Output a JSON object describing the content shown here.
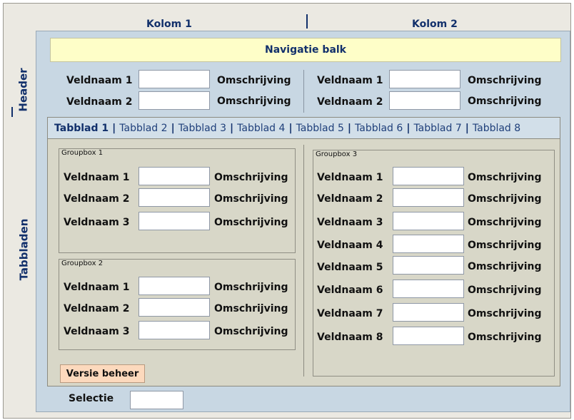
{
  "columns": {
    "col1": "Kolom 1",
    "col2": "Kolom 2"
  },
  "side_labels": {
    "header": "Header",
    "tabs": "Tabbladen"
  },
  "nav": {
    "label": "Navigatie balk"
  },
  "header_fields": {
    "left": [
      {
        "label": "Veldnaam 1",
        "desc": "Omschrijving",
        "value": ""
      },
      {
        "label": "Veldnaam 2",
        "desc": "Omschrijving",
        "value": ""
      }
    ],
    "right": [
      {
        "label": "Veldnaam 1",
        "desc": "Omschrijving",
        "value": ""
      },
      {
        "label": "Veldnaam 2",
        "desc": "Omschrijving",
        "value": ""
      }
    ]
  },
  "tabs": [
    "Tabblad 1",
    "Tabblad 2",
    "Tabblad 3",
    "Tabblad 4",
    "Tabblad 5",
    "Tabblad 6",
    "Tabblad 7",
    "Tabblad 8"
  ],
  "groupbox1": {
    "title": "Groupbox 1",
    "fields": [
      {
        "label": "Veldnaam 1",
        "desc": "Omschrijving",
        "value": ""
      },
      {
        "label": "Veldnaam 2",
        "desc": "Omschrijving",
        "value": ""
      },
      {
        "label": "Veldnaam 3",
        "desc": "Omschrijving",
        "value": ""
      }
    ]
  },
  "groupbox2": {
    "title": "Groupbox 2",
    "fields": [
      {
        "label": "Veldnaam 1",
        "desc": "Omschrijving",
        "value": ""
      },
      {
        "label": "Veldnaam 2",
        "desc": "Omschrijving",
        "value": ""
      },
      {
        "label": "Veldnaam 3",
        "desc": "Omschrijving",
        "value": ""
      }
    ]
  },
  "groupbox3": {
    "title": "Groupbox 3",
    "fields": [
      {
        "label": "Veldnaam 1",
        "desc": "Omschrijving",
        "value": ""
      },
      {
        "label": "Veldnaam 2",
        "desc": "Omschrijving",
        "value": ""
      },
      {
        "label": "Veldnaam 3",
        "desc": "Omschrijving",
        "value": ""
      },
      {
        "label": "Veldnaam 4",
        "desc": "Omschrijving",
        "value": ""
      },
      {
        "label": "Veldnaam 5",
        "desc": "Omschrijving",
        "value": ""
      },
      {
        "label": "Veldnaam 6",
        "desc": "Omschrijving",
        "value": ""
      },
      {
        "label": "Veldnaam 7",
        "desc": "Omschrijving",
        "value": ""
      },
      {
        "label": "Veldnaam 8",
        "desc": "Omschrijving",
        "value": ""
      }
    ]
  },
  "versie_button": "Versie beheer",
  "selectie": {
    "label": "Selectie",
    "value": ""
  }
}
